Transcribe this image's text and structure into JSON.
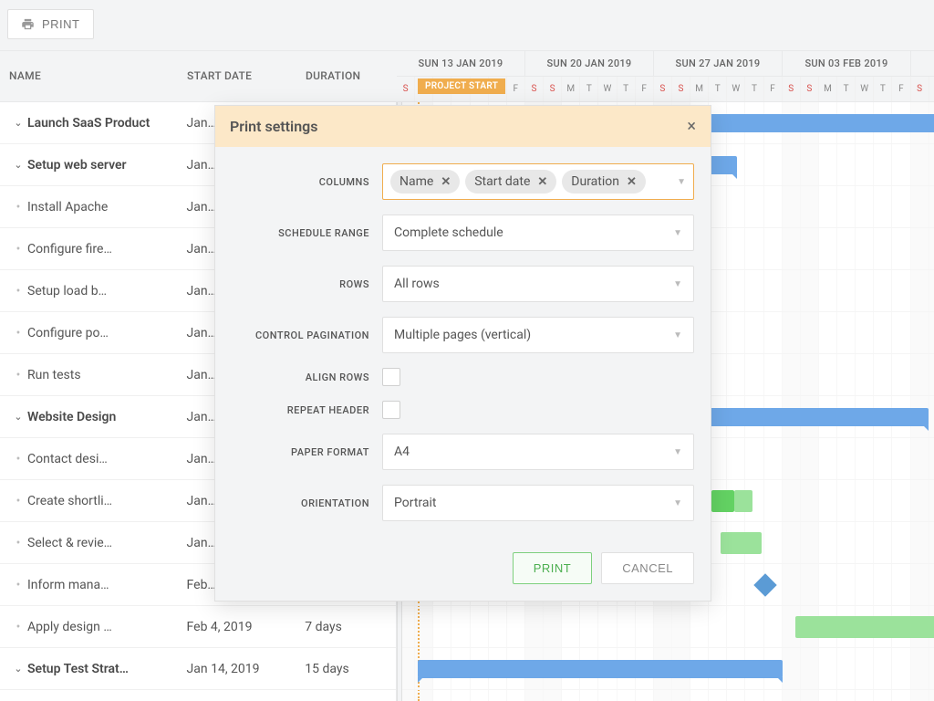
{
  "toolbar": {
    "print_label": "PRINT"
  },
  "columns": {
    "name": "NAME",
    "start": "START DATE",
    "duration": "DURATION"
  },
  "timeline": {
    "weeks": [
      "SUN 13 JAN 2019",
      "SUN 20 JAN 2019",
      "SUN 27 JAN 2019",
      "SUN 03 FEB 2019"
    ],
    "days": [
      "S",
      "S",
      "M",
      "T",
      "W",
      "T",
      "F",
      "S",
      "S",
      "M",
      "T",
      "W",
      "T",
      "F",
      "S",
      "S",
      "M",
      "T",
      "W",
      "T",
      "F",
      "S",
      "S",
      "M",
      "T",
      "W",
      "T",
      "F",
      "S"
    ],
    "project_start": "PROJECT START"
  },
  "tasks": [
    {
      "name": "Launch SaaS Product",
      "date": "Jan…",
      "dur": "",
      "level": 0,
      "bold": true,
      "chev": true
    },
    {
      "name": "Setup web server",
      "date": "Jan…",
      "dur": "",
      "level": 1,
      "bold": true,
      "chev": true
    },
    {
      "name": "Install Apache",
      "date": "Jan…",
      "dur": "",
      "level": 2,
      "bold": false
    },
    {
      "name": "Configure fire…",
      "date": "Jan…",
      "dur": "",
      "level": 2,
      "bold": false
    },
    {
      "name": "Setup load b…",
      "date": "Jan…",
      "dur": "",
      "level": 2,
      "bold": false
    },
    {
      "name": "Configure po…",
      "date": "Jan…",
      "dur": "",
      "level": 2,
      "bold": false
    },
    {
      "name": "Run tests",
      "date": "Jan…",
      "dur": "",
      "level": 2,
      "bold": false
    },
    {
      "name": "Website Design",
      "date": "Jan…",
      "dur": "",
      "level": 1,
      "bold": true,
      "chev": true
    },
    {
      "name": "Contact desi…",
      "date": "Jan…",
      "dur": "",
      "level": 2,
      "bold": false
    },
    {
      "name": "Create shortli…",
      "date": "Jan…",
      "dur": "",
      "level": 2,
      "bold": false
    },
    {
      "name": "Select & revie…",
      "date": "Jan…",
      "dur": "",
      "level": 2,
      "bold": false
    },
    {
      "name": "Inform mana…",
      "date": "Feb…",
      "dur": "",
      "level": 2,
      "bold": false
    },
    {
      "name": "Apply design …",
      "date": "Feb 4, 2019",
      "dur": "7 days",
      "level": 2,
      "bold": false
    },
    {
      "name": "Setup Test Strat…",
      "date": "Jan 14, 2019",
      "dur": "15 days",
      "level": 1,
      "bold": true,
      "chev": true
    }
  ],
  "modal": {
    "title": "Print settings",
    "labels": {
      "columns": "COLUMNS",
      "schedule_range": "SCHEDULE RANGE",
      "rows": "ROWS",
      "control_pagination": "CONTROL PAGINATION",
      "align_rows": "ALIGN ROWS",
      "repeat_header": "REPEAT HEADER",
      "paper_format": "PAPER FORMAT",
      "orientation": "ORIENTATION"
    },
    "tags": [
      "Name",
      "Start date",
      "Duration"
    ],
    "values": {
      "schedule_range": "Complete schedule",
      "rows": "All rows",
      "control_pagination": "Multiple pages (vertical)",
      "paper_format": "A4",
      "orientation": "Portrait"
    },
    "buttons": {
      "print": "PRINT",
      "cancel": "CANCEL"
    }
  }
}
